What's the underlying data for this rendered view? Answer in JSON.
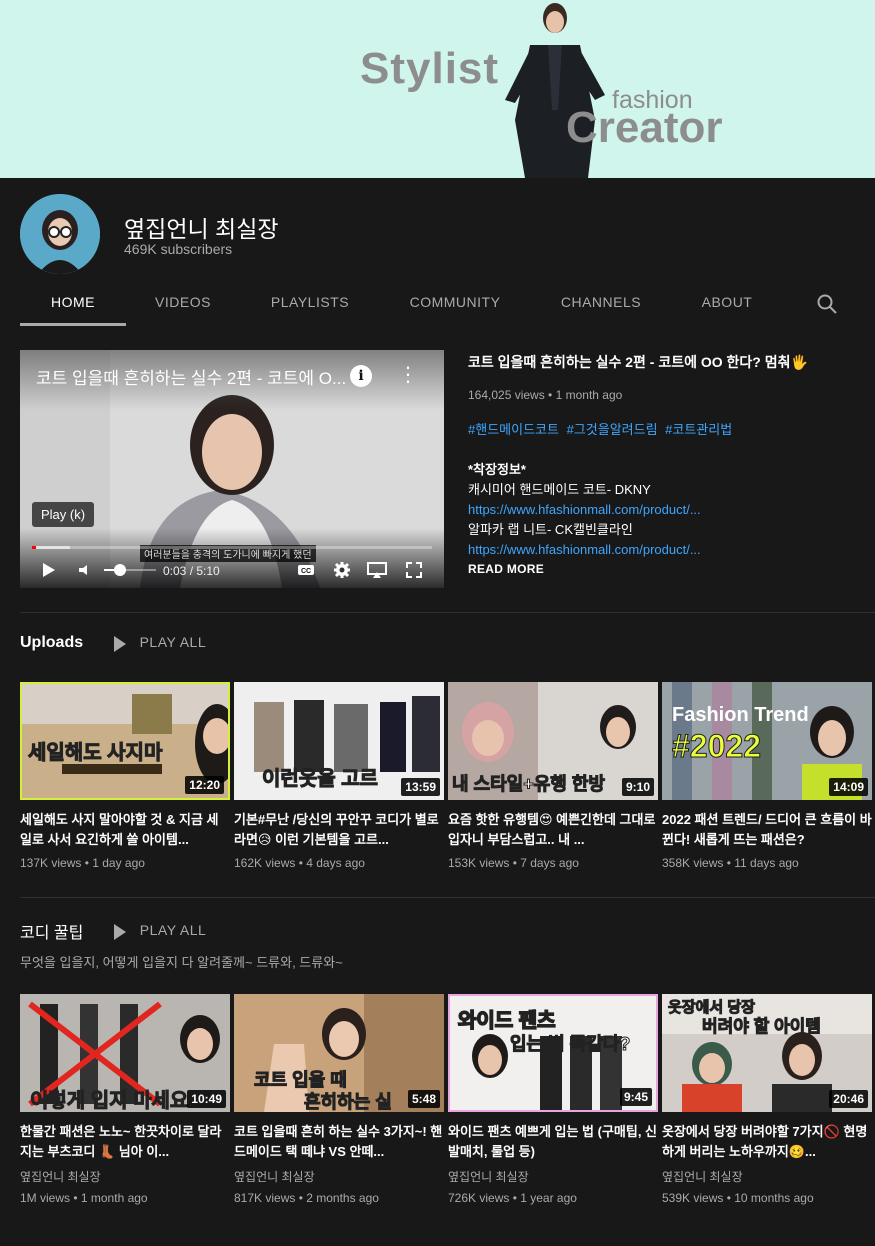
{
  "banner": {
    "word_stylist": "Stylist",
    "word_fashion": "fashion",
    "word_creator": "Creator"
  },
  "channel": {
    "name": "옆집언니 최실장",
    "subscribers": "469K subscribers"
  },
  "tabs": [
    "HOME",
    "VIDEOS",
    "PLAYLISTS",
    "COMMUNITY",
    "CHANNELS",
    "ABOUT"
  ],
  "featured": {
    "player_title": "코트 입을때 흔히하는 실수 2편 - 코트에 O...",
    "tooltip": "Play (k)",
    "caption": "여러분들을 충격의 도가니에 빠지게 했던",
    "time": "0:03 / 5:10",
    "progress_fraction": 0.01,
    "title": "코트 입을때 흔히하는 실수 2편 - 코트에 OO 한다? 멈춰🖐",
    "meta": "164,025 views • 1 month ago",
    "tags": [
      "#핸드메이드코트",
      "#그것을알려드림",
      "#코트관리법"
    ],
    "desc_heading": "*착장정보*",
    "desc_line1": "캐시미어 핸드메이드 코트- DKNY",
    "link1": "https://www.hfashionmall.com/product/...",
    "desc_line2": "알파카 랩 니트- CK캘빈클라인",
    "link2": "https://www.hfashionmall.com/product/...",
    "read_more": "READ MORE"
  },
  "shelves": [
    {
      "title": "Uploads",
      "play_all": "PLAY ALL",
      "subtitle": "",
      "videos": [
        {
          "title": "세일해도 사지 말아야할 것 & 지금 세일로 사서 요긴하게 쓸 아이템...",
          "channel": "",
          "meta": "137K views • 1 day ago",
          "duration": "12:20",
          "overlay": "세일해도 사지마"
        },
        {
          "title": "기본#무난 /당신의 꾸안꾸 코디가 별로라면😥 이런 기본템을 고르...",
          "channel": "",
          "meta": "162K views • 4 days ago",
          "duration": "13:59",
          "overlay": "이런옷을 고르"
        },
        {
          "title": "요즘 핫한 유행템😍 예쁜긴한데 그대로 입자니 부담스럽고.. 내 ...",
          "channel": "",
          "meta": "153K views • 7 days ago",
          "duration": "9:10",
          "overlay": "내 스타일+유행 한방"
        },
        {
          "title": "2022 패션 트렌드/ 드디어 큰 흐름이 바뀐다! 새롭게 뜨는 패션은?",
          "channel": "",
          "meta": "358K views • 11 days ago",
          "duration": "14:09",
          "overlay": "Fashion Trend"
        }
      ]
    },
    {
      "title": "코디 꿀팁",
      "play_all": "PLAY ALL",
      "subtitle": "무엇을 입을지, 어떻게 입을지 다 알려줄께~ 드류와, 드류와~",
      "videos": [
        {
          "title": "한물간 패션은 노노~ 한끗차이로 달라지는 부츠코디 👢 님아 이...",
          "channel": "옆집언니 최실장",
          "meta": "1M views • 1 month ago",
          "duration": "10:49",
          "overlay": "이렇게 입지 마세요"
        },
        {
          "title": "코트 입을때 흔히 하는 실수 3가지~! 핸드메이드 택 떼냐 VS 안떼...",
          "channel": "옆집언니 최실장",
          "meta": "817K views • 2 months ago",
          "duration": "5:48",
          "overlay": "코트 입을 때"
        },
        {
          "title": "와이드 팬츠 예쁘게 입는 법 (구매팁, 신발매치, 룰업 등)",
          "channel": "옆집언니 최실장",
          "meta": "726K views • 1 year ago",
          "duration": "9:45",
          "overlay": "와이드 팬츠"
        },
        {
          "title": "옷장에서 당장 버려야할 7가지🚫 현명하게 버리는 노하우까지🥴...",
          "channel": "옆집언니 최실장",
          "meta": "539K views • 10 months ago",
          "duration": "20:46",
          "overlay": "옷장에서 당장"
        }
      ]
    }
  ],
  "colors": {
    "background": "#181818",
    "banner": "#cff5ec",
    "link": "#3ea6ff",
    "progress": "#ff0000"
  }
}
